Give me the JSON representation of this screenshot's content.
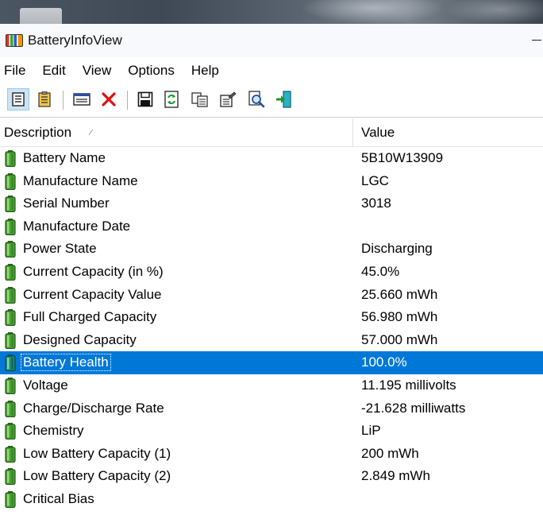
{
  "window": {
    "title": "BatteryInfoView"
  },
  "menu": {
    "items": [
      "File",
      "Edit",
      "View",
      "Options",
      "Help"
    ]
  },
  "toolbar": {
    "buttons": [
      {
        "icon": "properties-view-icon",
        "active": true
      },
      {
        "icon": "clipboard-list-icon",
        "active": false
      },
      {
        "icon": "log-window-icon",
        "active": false
      },
      {
        "icon": "delete-x-icon",
        "active": false
      },
      {
        "icon": "save-disk-icon",
        "active": false
      },
      {
        "icon": "refresh-icon",
        "active": false
      },
      {
        "icon": "copy-icon",
        "active": false
      },
      {
        "icon": "properties-icon",
        "active": false
      },
      {
        "icon": "find-icon",
        "active": false
      },
      {
        "icon": "exit-icon",
        "active": false
      }
    ]
  },
  "list": {
    "columns": {
      "description": "Description",
      "value": "Value"
    },
    "rows": [
      {
        "description": "Battery Name",
        "value": "5B10W13909"
      },
      {
        "description": "Manufacture Name",
        "value": "LGC"
      },
      {
        "description": "Serial Number",
        "value": " 3018"
      },
      {
        "description": "Manufacture Date",
        "value": ""
      },
      {
        "description": "Power State",
        "value": "Discharging"
      },
      {
        "description": "Current Capacity (in %)",
        "value": "45.0%"
      },
      {
        "description": "Current Capacity Value",
        "value": "25.660 mWh"
      },
      {
        "description": "Full Charged Capacity",
        "value": "56.980 mWh"
      },
      {
        "description": "Designed Capacity",
        "value": "57.000 mWh"
      },
      {
        "description": "Battery Health",
        "value": "100.0%",
        "selected": true
      },
      {
        "description": "Voltage",
        "value": "11.195 millivolts"
      },
      {
        "description": "Charge/Discharge Rate",
        "value": "-21.628 milliwatts"
      },
      {
        "description": "Chemistry",
        "value": "LiP"
      },
      {
        "description": "Low Battery Capacity (1)",
        "value": "200 mWh"
      },
      {
        "description": "Low Battery Capacity (2)",
        "value": "2.849 mWh"
      },
      {
        "description": "Critical Bias",
        "value": ""
      }
    ]
  },
  "colors": {
    "selection": "#0078d7",
    "battery_green": "#3c8c2a"
  }
}
